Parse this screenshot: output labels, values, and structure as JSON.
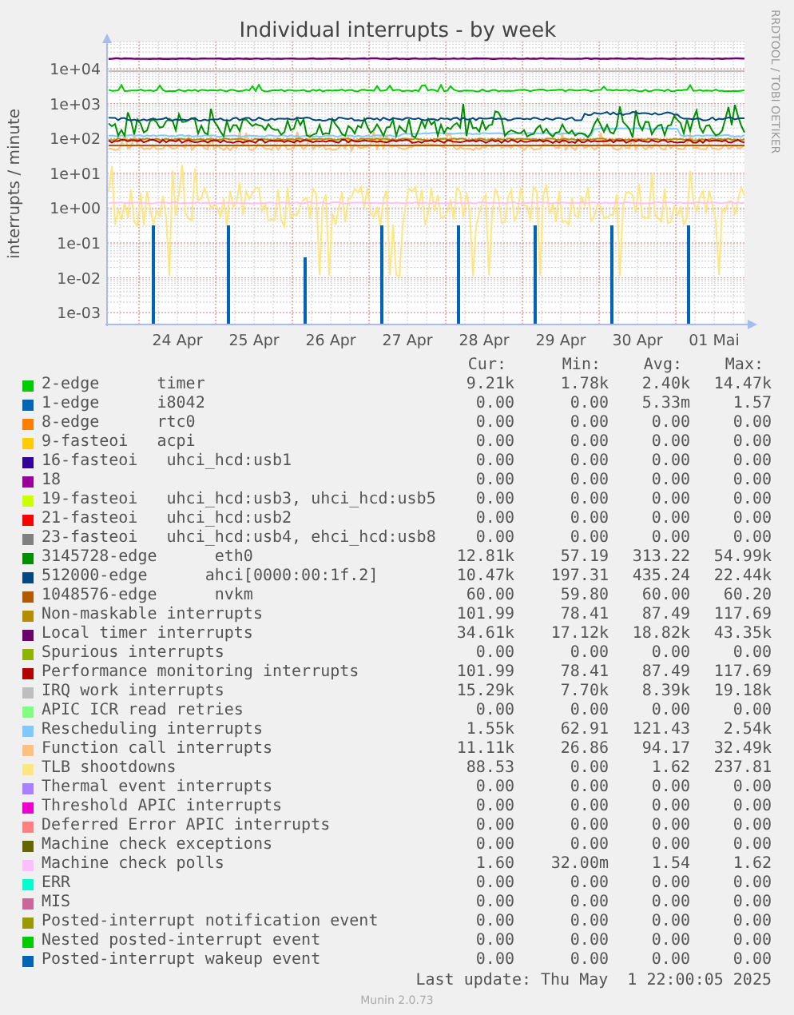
{
  "chart": {
    "title": "Individual interrupts - by week",
    "ylabel": "interrupts / minute",
    "credit": "RRDTOOL / TOBI OETIKER",
    "y_ticks": [
      "1e+04",
      "1e+03",
      "1e+02",
      "1e+01",
      "1e+00",
      "1e-01",
      "1e-02",
      "1e-03"
    ],
    "x_ticks": [
      "24 Apr",
      "25 Apr",
      "26 Apr",
      "27 Apr",
      "28 Apr",
      "29 Apr",
      "30 Apr",
      "01 Mai"
    ]
  },
  "legend": {
    "columns": [
      "Cur:",
      "Min:",
      "Avg:",
      "Max:"
    ],
    "rows": [
      {
        "name": "2-edge      timer",
        "color": "#00cc00",
        "cur": "9.21k",
        "min": "1.78k",
        "avg": "2.40k",
        "max": "14.47k"
      },
      {
        "name": "1-edge      i8042",
        "color": "#0066b3",
        "cur": "0.00",
        "min": "0.00",
        "avg": "5.33m",
        "max": "1.57"
      },
      {
        "name": "8-edge      rtc0",
        "color": "#ff8000",
        "cur": "0.00",
        "min": "0.00",
        "avg": "0.00",
        "max": "0.00"
      },
      {
        "name": "9-fasteoi   acpi",
        "color": "#ffcc00",
        "cur": "0.00",
        "min": "0.00",
        "avg": "0.00",
        "max": "0.00"
      },
      {
        "name": "16-fasteoi   uhci_hcd:usb1",
        "color": "#330099",
        "cur": "0.00",
        "min": "0.00",
        "avg": "0.00",
        "max": "0.00"
      },
      {
        "name": "18",
        "color": "#990099",
        "cur": "0.00",
        "min": "0.00",
        "avg": "0.00",
        "max": "0.00"
      },
      {
        "name": "19-fasteoi   uhci_hcd:usb3, uhci_hcd:usb5",
        "color": "#ccff00",
        "cur": "0.00",
        "min": "0.00",
        "avg": "0.00",
        "max": "0.00"
      },
      {
        "name": "21-fasteoi   uhci_hcd:usb2",
        "color": "#ff0000",
        "cur": "0.00",
        "min": "0.00",
        "avg": "0.00",
        "max": "0.00"
      },
      {
        "name": "23-fasteoi   uhci_hcd:usb4, ehci_hcd:usb8",
        "color": "#808080",
        "cur": "0.00",
        "min": "0.00",
        "avg": "0.00",
        "max": "0.00"
      },
      {
        "name": "3145728-edge      eth0",
        "color": "#008f00",
        "cur": "12.81k",
        "min": "57.19",
        "avg": "313.22",
        "max": "54.99k"
      },
      {
        "name": "512000-edge      ahci[0000:00:1f.2]",
        "color": "#00487d",
        "cur": "10.47k",
        "min": "197.31",
        "avg": "435.24",
        "max": "22.44k"
      },
      {
        "name": "1048576-edge      nvkm",
        "color": "#b35a00",
        "cur": "60.00",
        "min": "59.80",
        "avg": "60.00",
        "max": "60.20"
      },
      {
        "name": "Non-maskable interrupts",
        "color": "#b38f00",
        "cur": "101.99",
        "min": "78.41",
        "avg": "87.49",
        "max": "117.69"
      },
      {
        "name": "Local timer interrupts",
        "color": "#6b006b",
        "cur": "34.61k",
        "min": "17.12k",
        "avg": "18.82k",
        "max": "43.35k"
      },
      {
        "name": "Spurious interrupts",
        "color": "#8fb300",
        "cur": "0.00",
        "min": "0.00",
        "avg": "0.00",
        "max": "0.00"
      },
      {
        "name": "Performance monitoring interrupts",
        "color": "#b30000",
        "cur": "101.99",
        "min": "78.41",
        "avg": "87.49",
        "max": "117.69"
      },
      {
        "name": "IRQ work interrupts",
        "color": "#bebebe",
        "cur": "15.29k",
        "min": "7.70k",
        "avg": "8.39k",
        "max": "19.18k"
      },
      {
        "name": "APIC ICR read retries",
        "color": "#80ff80",
        "cur": "0.00",
        "min": "0.00",
        "avg": "0.00",
        "max": "0.00"
      },
      {
        "name": "Rescheduling interrupts",
        "color": "#80c9ff",
        "cur": "1.55k",
        "min": "62.91",
        "avg": "121.43",
        "max": "2.54k"
      },
      {
        "name": "Function call interrupts",
        "color": "#ffc080",
        "cur": "11.11k",
        "min": "26.86",
        "avg": "94.17",
        "max": "32.49k"
      },
      {
        "name": "TLB shootdowns",
        "color": "#ffe680",
        "cur": "88.53",
        "min": "0.00",
        "avg": "1.62",
        "max": "237.81"
      },
      {
        "name": "Thermal event interrupts",
        "color": "#aa80ff",
        "cur": "0.00",
        "min": "0.00",
        "avg": "0.00",
        "max": "0.00"
      },
      {
        "name": "Threshold APIC interrupts",
        "color": "#ee00cc",
        "cur": "0.00",
        "min": "0.00",
        "avg": "0.00",
        "max": "0.00"
      },
      {
        "name": "Deferred Error APIC interrupts",
        "color": "#ff8080",
        "cur": "0.00",
        "min": "0.00",
        "avg": "0.00",
        "max": "0.00"
      },
      {
        "name": "Machine check exceptions",
        "color": "#666600",
        "cur": "0.00",
        "min": "0.00",
        "avg": "0.00",
        "max": "0.00"
      },
      {
        "name": "Machine check polls",
        "color": "#ffbfff",
        "cur": "1.60",
        "min": "32.00m",
        "avg": "1.54",
        "max": "1.62"
      },
      {
        "name": "ERR",
        "color": "#00ffcc",
        "cur": "0.00",
        "min": "0.00",
        "avg": "0.00",
        "max": "0.00"
      },
      {
        "name": "MIS",
        "color": "#cc6699",
        "cur": "0.00",
        "min": "0.00",
        "avg": "0.00",
        "max": "0.00"
      },
      {
        "name": "Posted-interrupt notification event",
        "color": "#999900",
        "cur": "0.00",
        "min": "0.00",
        "avg": "0.00",
        "max": "0.00"
      },
      {
        "name": "Nested posted-interrupt event",
        "color": "#00cc00",
        "cur": "0.00",
        "min": "0.00",
        "avg": "0.00",
        "max": "0.00"
      },
      {
        "name": "Posted-interrupt wakeup event",
        "color": "#0066b3",
        "cur": "0.00",
        "min": "0.00",
        "avg": "0.00",
        "max": "0.00"
      }
    ]
  },
  "last_update": "Last update: Thu May  1 22:00:05 2025",
  "version": "Munin 2.0.73"
}
